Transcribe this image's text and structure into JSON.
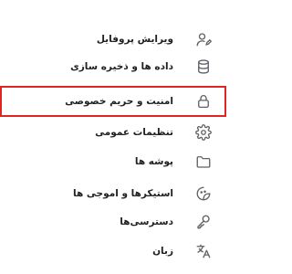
{
  "menu": {
    "items": [
      {
        "label": "ویرایش پروفایل",
        "icon": "user-edit-icon"
      },
      {
        "label": "داده ها و ذخیره سازی",
        "icon": "database-icon"
      },
      {
        "label": "امنیت و حریم خصوصی",
        "icon": "lock-icon",
        "highlighted": true
      },
      {
        "label": "تنظیمات عمومی",
        "icon": "gear-icon"
      },
      {
        "label": "پوشه ها",
        "icon": "folder-icon"
      },
      {
        "label": "استیکرها و اموجی ها",
        "icon": "sticker-icon"
      },
      {
        "label": "دسترسی‌ها",
        "icon": "key-icon"
      },
      {
        "label": "زبان",
        "icon": "translate-icon"
      }
    ]
  },
  "colors": {
    "text": "#212121",
    "icon": "#5f6368",
    "highlight_border": "#e02424",
    "background": "#ffffff"
  }
}
